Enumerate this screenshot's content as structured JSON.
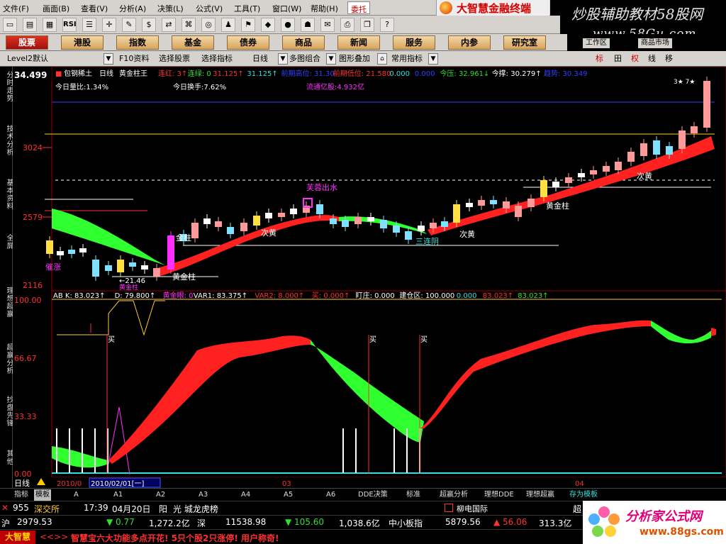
{
  "menu": [
    "文件(F)",
    "画面(B)",
    "查看(V)",
    "分析(A)",
    "决策(L)",
    "公式(V)",
    "工具(T)",
    "窗口(W)",
    "帮助(H)"
  ],
  "tuo_label": "委托",
  "brand_title": "大智慧金融终端",
  "watermark": {
    "line1": "炒股辅助教材58股网",
    "line2": "www.58Gu.com"
  },
  "toolbar_icons": [
    "open-icon",
    "chart-icon",
    "grid-icon",
    "rsi-icon",
    "list-icon",
    "cross-icon",
    "ruler-icon",
    "dollar-icon",
    "exchange-icon",
    "tree-icon",
    "binoculars-icon",
    "group-icon",
    "flag-icon",
    "shield-icon",
    "coin-icon",
    "trade-icon",
    "stamp-icon",
    "print-icon",
    "copy-icon",
    "help-icon"
  ],
  "toolbar_text": {
    "rsi": "RSI",
    "help": "?"
  },
  "nav": [
    "股票",
    "港股",
    "指数",
    "基金",
    "债券",
    "商品",
    "新闻",
    "服务",
    "内参",
    "研究室"
  ],
  "nav_right": [
    "工作区",
    "商品市场"
  ],
  "ctrl": {
    "level2": "Level2默认",
    "f10": "F10资料",
    "select_stock": "选择股票",
    "select_indicator": "选择指标",
    "period": "日线",
    "multi": "多图组合",
    "overlay": "图形叠加",
    "common": "常用指标",
    "right_btns": [
      "标",
      "田",
      "权",
      "线",
      "移"
    ]
  },
  "left_tabs": [
    "分时走势",
    "技术分析",
    "基本资料",
    "全屏",
    "理想超赢",
    "超赢分析",
    "抄盘先锋",
    "其他"
  ],
  "chart": {
    "price_top": "34.499",
    "price_mid": "3024",
    "price_low": "2579",
    "price_bottom": "2116",
    "stock_title": "包钢稀土",
    "period": "日线",
    "indicator": "黄金柱王",
    "header_items": [
      {
        "text": "连红: 3↑",
        "color": "#ff3030"
      },
      {
        "text": "连绿: 0",
        "color": "#30e030"
      },
      {
        "text": "31.125↑",
        "color": "#ff3030"
      },
      {
        "text": "31.125↑",
        "color": "#30e0e0"
      },
      {
        "text": "前期高位: 31.30",
        "color": "#3040ff"
      },
      {
        "text": "前期低位: 21.580",
        "color": "#ff3030"
      },
      {
        "text": "0.000",
        "color": "#30e0e0"
      },
      {
        "text": "0.000",
        "color": "#3040ff"
      },
      {
        "text": "今压: 32.961↓",
        "color": "#30e030"
      },
      {
        "text": "今撑: 30.279↑",
        "color": "#ffffff"
      },
      {
        "text": "趋势: 30.349",
        "color": "#3040ff"
      }
    ],
    "row2_left": "今日量比:1.34%",
    "row2_mid": "今日换手:7.62%",
    "row2_right": "流通亿股:4.932亿",
    "annotations": {
      "lu_chu": "芙蓉出水",
      "zhang": "涨",
      "yan_zhang": "催涨",
      "low_label": "←21.46",
      "gold_col": "黄金柱",
      "gold_col2": "黄金柱",
      "gold_col3": "黄金柱",
      "gold_col4": "金柱",
      "ci_huang1": "次黄",
      "ci_huang2": "次黄",
      "ci_huang3": "次黄",
      "san_lian_yin": "三连阴",
      "top_marker": "3★ 7★"
    },
    "sub_axis": [
      "100.00",
      "66.67",
      "33.33",
      "0.00"
    ],
    "sub_header": [
      {
        "text": "AB K: 83.023↑",
        "color": "#ffffff"
      },
      {
        "text": "D: 79.800↑",
        "color": "#ffffff"
      },
      {
        "text": "黄金眼: 0",
        "color": "#ff30ff"
      },
      {
        "text": "VAR1: 83.375↑",
        "color": "#ffffff"
      },
      {
        "text": "VAR2: 8.000↑",
        "color": "#ff3030"
      },
      {
        "text": "买: 0.000↑",
        "color": "#ff3030"
      },
      {
        "text": "盯庄: 0.000",
        "color": "#ffffff"
      },
      {
        "text": "建仓区: 100.000",
        "color": "#ffffff"
      },
      {
        "text": "0.000",
        "color": "#30e0e0"
      },
      {
        "text": "83.023↑",
        "color": "#ff3030"
      },
      {
        "text": "83.023↑",
        "color": "#30e030"
      }
    ],
    "buy_label": "买",
    "x_axis": {
      "date_left": "2010/0",
      "date_sel": "2010/02/01[一]",
      "mark3": "03",
      "mark4": "04"
    },
    "day_line_label": "日线"
  },
  "tabs": [
    "指标",
    "模板",
    "A",
    "A1",
    "A2",
    "A3",
    "A4",
    "A5",
    "A6",
    "DDE决策",
    "标准",
    "超赢分析",
    "理想DDE",
    "理想超赢",
    "存为模板"
  ],
  "status1": {
    "code": "955",
    "exch": "深交所",
    "time": "17:39",
    "date": "04月20日",
    "weekday": "阳",
    "right": "光 城龙虎榜",
    "extra": "超"
  },
  "status2": {
    "sh": "沪",
    "sh_idx": "2979.53",
    "sh_chg": "▼ 0.77",
    "sh_amt": "1,272.2亿",
    "sz": "深",
    "sz_idx": "11538.98",
    "sz_chg": "▼ 105.60",
    "sz_amt": "1,038.6亿",
    "zx": "中小板指",
    "zx_idx": "5879.56",
    "zx_chg": "▲ 56.06",
    "zx_amt": "313.3亿"
  },
  "status3": {
    "dzh": "大智慧",
    "arrows": "<<>>",
    "ticker": "智慧宝六大功能多点开花! 5只个股2只涨停! 用户称奇!"
  },
  "logo2": {
    "t1": "分析家公式网",
    "t2": "www.88gs.com"
  },
  "news_tag": "柳电国际"
}
